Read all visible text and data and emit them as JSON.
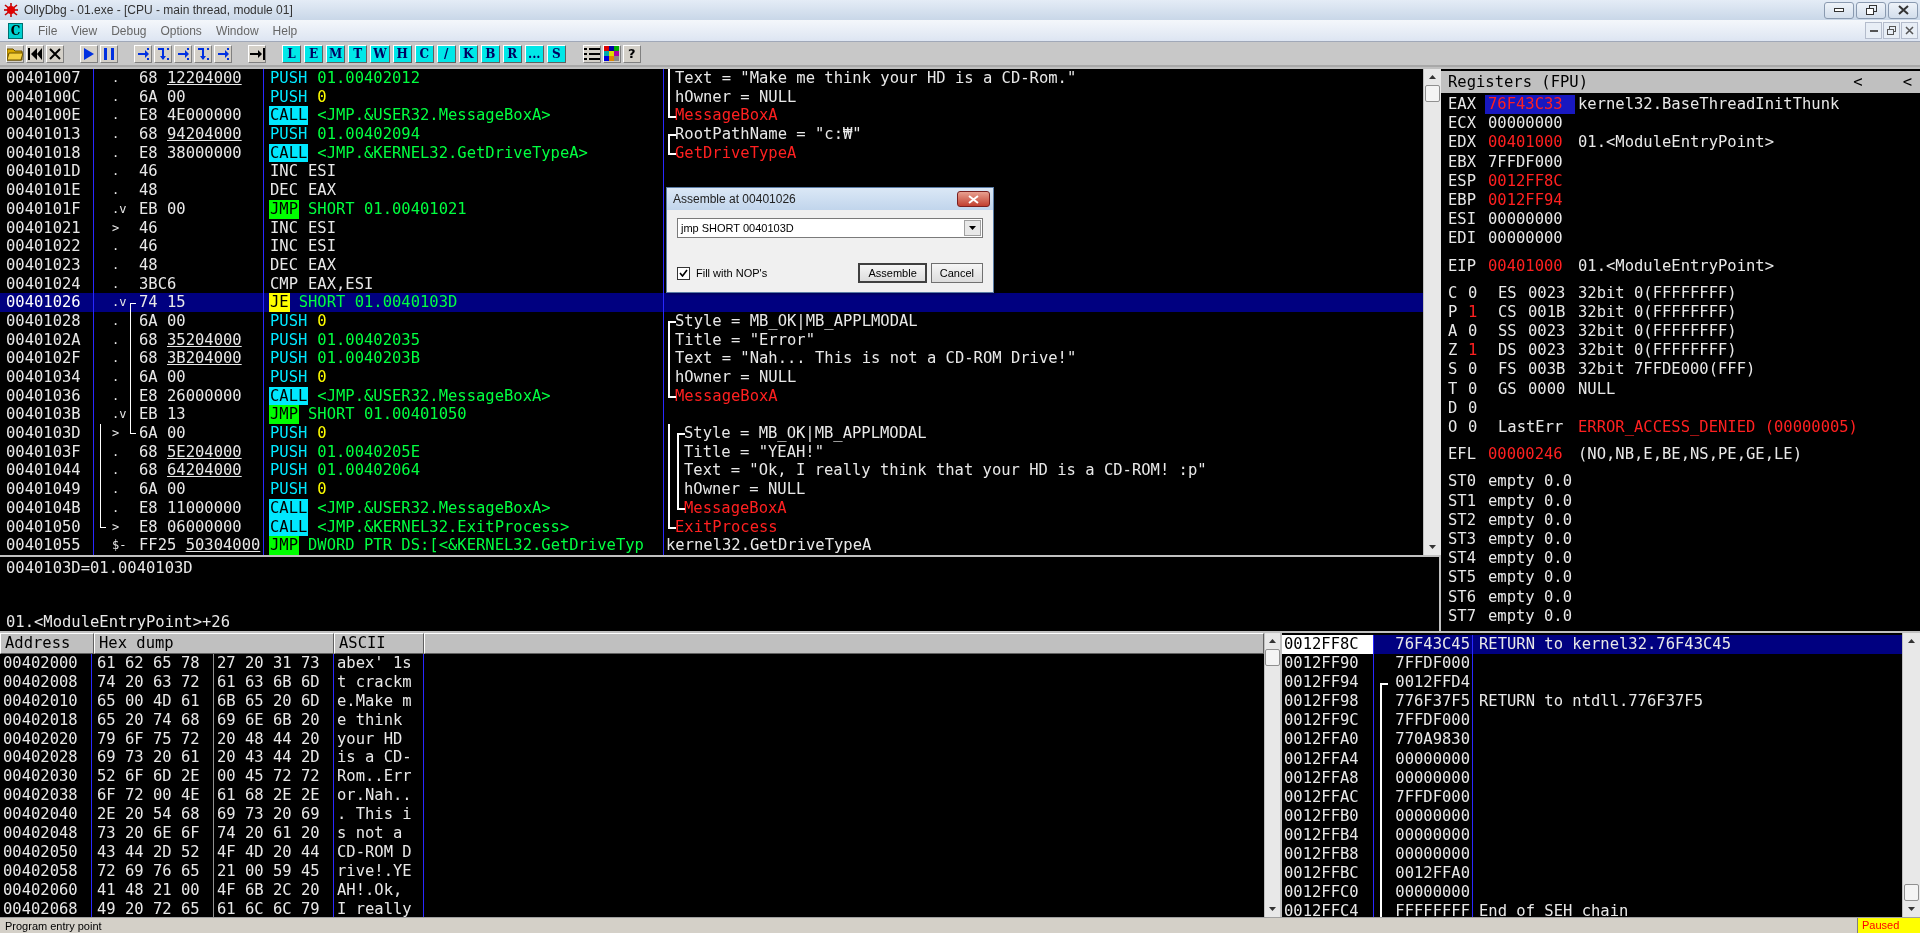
{
  "window": {
    "title": "OllyDbg - 01.exe - [CPU - main thread, module 01]"
  },
  "menu": {
    "cpu_badge": "C",
    "items": [
      "File",
      "View",
      "Debug",
      "Options",
      "Window",
      "Help"
    ]
  },
  "toolbar": {
    "letters": [
      "L",
      "E",
      "M",
      "T",
      "W",
      "H",
      "C",
      "/",
      "K",
      "B",
      "R",
      "...",
      "S"
    ],
    "help": "?"
  },
  "disassembly": {
    "rows": [
      {
        "address": "00401007",
        "marker": ".",
        "opcode": "68",
        "operand": "12204000",
        "fixup": true,
        "instruction": {
          "kind": "push",
          "mnemonic": "PUSH",
          "args": {
            "text": "01.00402012",
            "kind": "address"
          }
        },
        "selected": false,
        "comment": {
          "text": "Text = \"Make me think your HD is a CD-Rom.\"",
          "kind": "arg",
          "bracket": {
            "kind": "mid"
          }
        }
      },
      {
        "address": "0040100C",
        "marker": ".",
        "opcode": "6A",
        "operand": "00",
        "fixup": false,
        "instruction": {
          "kind": "push",
          "mnemonic": "PUSH",
          "args": {
            "text": "0",
            "kind": "const"
          }
        },
        "selected": false,
        "comment": {
          "text": "hOwner = NULL",
          "kind": "arg",
          "bracket": {
            "kind": "mid"
          }
        }
      },
      {
        "address": "0040100E",
        "marker": ".",
        "opcode": "E8",
        "operand": "4E000000",
        "fixup": false,
        "instruction": {
          "kind": "call",
          "mnemonic": "CALL",
          "args": {
            "text": "<JMP.&USER32.MessageBoxA>",
            "kind": "address"
          }
        },
        "selected": false,
        "comment": {
          "text": "MessageBoxA",
          "kind": "api",
          "bracket": {
            "kind": "end"
          }
        }
      },
      {
        "address": "00401013",
        "marker": ".",
        "opcode": "68",
        "operand": "94204000",
        "fixup": true,
        "instruction": {
          "kind": "push",
          "mnemonic": "PUSH",
          "args": {
            "text": "01.00402094",
            "kind": "address"
          }
        },
        "selected": false,
        "comment": {
          "text": "RootPathName = \"c:₩\"",
          "kind": "arg",
          "bracket": {
            "kind": "start"
          }
        }
      },
      {
        "address": "00401018",
        "marker": ".",
        "opcode": "E8",
        "operand": "38000000",
        "fixup": false,
        "instruction": {
          "kind": "call",
          "mnemonic": "CALL",
          "args": {
            "text": "<JMP.&KERNEL32.GetDriveTypeA>",
            "kind": "address"
          }
        },
        "selected": false,
        "comment": {
          "text": "GetDriveTypeA",
          "kind": "api",
          "bracket": {
            "kind": "end"
          }
        }
      },
      {
        "address": "0040101D",
        "marker": ".",
        "opcode": "46",
        "instruction": {
          "kind": "plain",
          "mnemonic": "INC",
          "args": {
            "text": "ESI",
            "kind": "plain"
          }
        },
        "selected": false
      },
      {
        "address": "0040101E",
        "marker": ".",
        "opcode": "48",
        "instruction": {
          "kind": "plain",
          "mnemonic": "DEC",
          "args": {
            "text": "EAX",
            "kind": "plain"
          }
        },
        "selected": false
      },
      {
        "address": "0040101F",
        "marker": ".v",
        "opcode": "EB",
        "operand": "00",
        "fixup": false,
        "instruction": {
          "kind": "jmp",
          "mnemonic": "JMP",
          "args": {
            "text": "SHORT 01.00401021",
            "kind": "address"
          }
        },
        "selected": false
      },
      {
        "address": "00401021",
        "marker": ">",
        "opcode": "46",
        "instruction": {
          "kind": "plain",
          "mnemonic": "INC",
          "args": {
            "text": "ESI",
            "kind": "plain"
          }
        },
        "selected": false
      },
      {
        "address": "00401022",
        "marker": ".",
        "opcode": "46",
        "instruction": {
          "kind": "plain",
          "mnemonic": "INC",
          "args": {
            "text": "ESI",
            "kind": "plain"
          }
        },
        "selected": false
      },
      {
        "address": "00401023",
        "marker": ".",
        "opcode": "48",
        "instruction": {
          "kind": "plain",
          "mnemonic": "DEC",
          "args": {
            "text": "EAX",
            "kind": "plain"
          }
        },
        "selected": false
      },
      {
        "address": "00401024",
        "marker": ".",
        "opcode": "3BC6",
        "instruction": {
          "kind": "plain",
          "mnemonic": "CMP",
          "args": {
            "text": "EAX,ESI",
            "kind": "plain"
          }
        },
        "selected": false
      },
      {
        "address": "00401026",
        "marker": ".v",
        "opcode": "74",
        "operand": "15",
        "fixup": false,
        "instruction": {
          "kind": "jcc",
          "mnemonic": "JE",
          "args": {
            "text": "SHORT 01.0040103D",
            "kind": "address"
          }
        },
        "selected": true,
        "jump": {
          "kind": "start"
        }
      },
      {
        "address": "00401028",
        "marker": ".",
        "opcode": "6A",
        "operand": "00",
        "fixup": false,
        "instruction": {
          "kind": "push",
          "mnemonic": "PUSH",
          "args": {
            "text": "0",
            "kind": "const"
          }
        },
        "selected": false,
        "jump": {
          "kind": "mid"
        },
        "comment": {
          "text": "Style = MB_OK|MB_APPLMODAL",
          "kind": "arg",
          "bracket": {
            "kind": "start"
          }
        }
      },
      {
        "address": "0040102A",
        "marker": ".",
        "opcode": "68",
        "operand": "35204000",
        "fixup": true,
        "instruction": {
          "kind": "push",
          "mnemonic": "PUSH",
          "args": {
            "text": "01.00402035",
            "kind": "address"
          }
        },
        "selected": false,
        "jump": {
          "kind": "mid"
        },
        "comment": {
          "text": "Title = \"Error\"",
          "kind": "arg",
          "bracket": {
            "kind": "mid"
          }
        }
      },
      {
        "address": "0040102F",
        "marker": ".",
        "opcode": "68",
        "operand": "3B204000",
        "fixup": true,
        "instruction": {
          "kind": "push",
          "mnemonic": "PUSH",
          "args": {
            "text": "01.0040203B",
            "kind": "address"
          }
        },
        "selected": false,
        "jump": {
          "kind": "mid"
        },
        "comment": {
          "text": "Text = \"Nah... This is not a CD-ROM Drive!\"",
          "kind": "arg",
          "bracket": {
            "kind": "mid"
          }
        }
      },
      {
        "address": "00401034",
        "marker": ".",
        "opcode": "6A",
        "operand": "00",
        "fixup": false,
        "instruction": {
          "kind": "push",
          "mnemonic": "PUSH",
          "args": {
            "text": "0",
            "kind": "const"
          }
        },
        "selected": false,
        "jump": {
          "kind": "mid"
        },
        "comment": {
          "text": "hOwner = NULL",
          "kind": "arg",
          "bracket": {
            "kind": "mid"
          }
        }
      },
      {
        "address": "00401036",
        "marker": ".",
        "opcode": "E8",
        "operand": "26000000",
        "fixup": false,
        "instruction": {
          "kind": "call",
          "mnemonic": "CALL",
          "args": {
            "text": "<JMP.&USER32.MessageBoxA>",
            "kind": "address"
          }
        },
        "selected": false,
        "jump": {
          "kind": "mid"
        },
        "comment": {
          "text": "MessageBoxA",
          "kind": "api",
          "bracket": {
            "kind": "end"
          }
        }
      },
      {
        "address": "0040103B",
        "marker": ".v",
        "opcode": "EB",
        "operand": "13",
        "fixup": false,
        "instruction": {
          "kind": "jmp",
          "mnemonic": "JMP",
          "args": {
            "text": "SHORT 01.00401050",
            "kind": "address"
          }
        },
        "selected": false,
        "jump": {
          "kind": "mid"
        }
      },
      {
        "address": "0040103D",
        "marker": ">",
        "opcode": "6A",
        "operand": "00",
        "fixup": false,
        "instruction": {
          "kind": "push",
          "mnemonic": "PUSH",
          "args": {
            "text": "0",
            "kind": "const"
          }
        },
        "selected": false,
        "jump": {
          "kind": "end"
        },
        "jump_outer": {
          "kind": "mid"
        },
        "comment": {
          "text": "Style = MB_OK|MB_APPLMODAL",
          "kind": "arg",
          "bracket": {
            "kind": "start"
          },
          "outer": {
            "kind": "mid"
          }
        }
      },
      {
        "address": "0040103F",
        "marker": ".",
        "opcode": "68",
        "operand": "5E204000",
        "fixup": true,
        "instruction": {
          "kind": "push",
          "mnemonic": "PUSH",
          "args": {
            "text": "01.0040205E",
            "kind": "address"
          }
        },
        "selected": false,
        "jump_outer": {
          "kind": "mid"
        },
        "comment": {
          "text": "Title = \"YEAH!\"",
          "kind": "arg",
          "bracket": {
            "kind": "mid"
          },
          "outer": {
            "kind": "mid"
          }
        }
      },
      {
        "address": "00401044",
        "marker": ".",
        "opcode": "68",
        "operand": "64204000",
        "fixup": true,
        "instruction": {
          "kind": "push",
          "mnemonic": "PUSH",
          "args": {
            "text": "01.00402064",
            "kind": "address"
          }
        },
        "selected": false,
        "jump_outer": {
          "kind": "mid"
        },
        "comment": {
          "text": "Text = \"Ok, I really think that your HD is a CD-ROM! :p\"",
          "kind": "arg",
          "bracket": {
            "kind": "mid"
          },
          "outer": {
            "kind": "mid"
          }
        }
      },
      {
        "address": "00401049",
        "marker": ".",
        "opcode": "6A",
        "operand": "00",
        "fixup": false,
        "instruction": {
          "kind": "push",
          "mnemonic": "PUSH",
          "args": {
            "text": "0",
            "kind": "const"
          }
        },
        "selected": false,
        "jump_outer": {
          "kind": "mid"
        },
        "comment": {
          "text": "hOwner = NULL",
          "kind": "arg",
          "bracket": {
            "kind": "mid"
          },
          "outer": {
            "kind": "mid"
          }
        }
      },
      {
        "address": "0040104B",
        "marker": ".",
        "opcode": "E8",
        "operand": "11000000",
        "fixup": false,
        "instruction": {
          "kind": "call",
          "mnemonic": "CALL",
          "args": {
            "text": "<JMP.&USER32.MessageBoxA>",
            "kind": "address"
          }
        },
        "selected": false,
        "jump_outer": {
          "kind": "mid"
        },
        "comment": {
          "text": "MessageBoxA",
          "kind": "api",
          "bracket": {
            "kind": "end"
          },
          "outer": {
            "kind": "mid"
          }
        }
      },
      {
        "address": "00401050",
        "marker": ">",
        "opcode": "E8",
        "operand": "06000000",
        "fixup": false,
        "instruction": {
          "kind": "call",
          "mnemonic": "CALL",
          "args": {
            "text": "<JMP.&KERNEL32.ExitProcess>",
            "kind": "address"
          }
        },
        "selected": false,
        "jump_outer": {
          "kind": "end"
        },
        "comment": {
          "text": "ExitProcess",
          "kind": "api",
          "bracket": {
            "kind": "end"
          }
        }
      },
      {
        "address": "00401055",
        "marker": "$-",
        "opcode": "FF25",
        "operand": "50304000",
        "fixup": true,
        "instruction": {
          "kind": "jmp",
          "mnemonic": "JMP",
          "args": {
            "text": "DWORD PTR DS:[<&KERNEL32.GetDriveTyp",
            "kind": "address"
          }
        },
        "selected": false,
        "comment": {
          "text": "kernel32.GetDriveTypeA",
          "kind": "plain"
        }
      }
    ]
  },
  "info": {
    "value_line": "0040103D=01.0040103D",
    "location": "01.<ModuleEntryPoint>+26"
  },
  "registers": {
    "title": "Registers (FPU)",
    "arrows": [
      "<",
      "<"
    ],
    "general": [
      {
        "name": "EAX",
        "value": "76F43C33",
        "changed": true,
        "selected": true,
        "comment": "kernel32.BaseThreadInitThunk"
      },
      {
        "name": "ECX",
        "value": "00000000",
        "changed": false,
        "selected": false
      },
      {
        "name": "EDX",
        "value": "00401000",
        "changed": true,
        "selected": false,
        "comment": "01.<ModuleEntryPoint>"
      },
      {
        "name": "EBX",
        "value": "7FFDF000",
        "changed": false,
        "selected": false
      },
      {
        "name": "ESP",
        "value": "0012FF8C",
        "changed": true,
        "selected": false
      },
      {
        "name": "EBP",
        "value": "0012FF94",
        "changed": true,
        "selected": false
      },
      {
        "name": "ESI",
        "value": "00000000",
        "changed": false,
        "selected": false
      },
      {
        "name": "EDI",
        "value": "00000000",
        "changed": false,
        "selected": false
      }
    ],
    "eip": {
      "name": "EIP",
      "value": "00401000",
      "changed": true,
      "selected": false,
      "comment": "01.<ModuleEntryPoint>"
    },
    "flags": [
      {
        "name": "C",
        "value": "0",
        "changed": false,
        "segment": {
          "name": "ES",
          "selector": "0023",
          "info": "32bit 0(FFFFFFFF)"
        }
      },
      {
        "name": "P",
        "value": "1",
        "changed": true,
        "segment": {
          "name": "CS",
          "selector": "001B",
          "info": "32bit 0(FFFFFFFF)"
        }
      },
      {
        "name": "A",
        "value": "0",
        "changed": false,
        "segment": {
          "name": "SS",
          "selector": "0023",
          "info": "32bit 0(FFFFFFFF)"
        }
      },
      {
        "name": "Z",
        "value": "1",
        "changed": true,
        "segment": {
          "name": "DS",
          "selector": "0023",
          "info": "32bit 0(FFFFFFFF)"
        }
      },
      {
        "name": "S",
        "value": "0",
        "changed": false,
        "segment": {
          "name": "FS",
          "selector": "003B",
          "info": "32bit 7FFDE000(FFF)"
        }
      },
      {
        "name": "T",
        "value": "0",
        "changed": false,
        "segment": {
          "name": "GS",
          "selector": "0000",
          "info": "NULL"
        }
      },
      {
        "name": "D",
        "value": "0",
        "changed": false
      },
      {
        "name": "O",
        "value": "0",
        "changed": false,
        "last_error": {
          "label": "LastErr",
          "value": "ERROR_ACCESS_DENIED (00000005)"
        }
      }
    ],
    "efl": {
      "name": "EFL",
      "value": "00000246",
      "changed": true,
      "selected": false,
      "comment": "(NO,NB,E,BE,NS,PE,GE,LE)"
    },
    "fpu": [
      {
        "name": "ST0",
        "value": "empty 0.0"
      },
      {
        "name": "ST1",
        "value": "empty 0.0"
      },
      {
        "name": "ST2",
        "value": "empty 0.0"
      },
      {
        "name": "ST3",
        "value": "empty 0.0"
      },
      {
        "name": "ST4",
        "value": "empty 0.0"
      },
      {
        "name": "ST5",
        "value": "empty 0.0"
      },
      {
        "name": "ST6",
        "value": "empty 0.0"
      },
      {
        "name": "ST7",
        "value": "empty 0.0"
      }
    ]
  },
  "dump": {
    "columns": [
      "Address",
      "Hex dump",
      "ASCII"
    ],
    "rows": [
      {
        "address": "00402000",
        "hex": [
          "61 62 65 78",
          "27 20 31 73"
        ],
        "ascii": "abex' 1s"
      },
      {
        "address": "00402008",
        "hex": [
          "74 20 63 72",
          "61 63 6B 6D"
        ],
        "ascii": "t crackm"
      },
      {
        "address": "00402010",
        "hex": [
          "65 00 4D 61",
          "6B 65 20 6D"
        ],
        "ascii": "e.Make m"
      },
      {
        "address": "00402018",
        "hex": [
          "65 20 74 68",
          "69 6E 6B 20"
        ],
        "ascii": "e think"
      },
      {
        "address": "00402020",
        "hex": [
          "79 6F 75 72",
          "20 48 44 20"
        ],
        "ascii": "your HD"
      },
      {
        "address": "00402028",
        "hex": [
          "69 73 20 61",
          "20 43 44 2D"
        ],
        "ascii": "is a CD-"
      },
      {
        "address": "00402030",
        "hex": [
          "52 6F 6D 2E",
          "00 45 72 72"
        ],
        "ascii": "Rom..Err"
      },
      {
        "address": "00402038",
        "hex": [
          "6F 72 00 4E",
          "61 68 2E 2E"
        ],
        "ascii": "or.Nah.."
      },
      {
        "address": "00402040",
        "hex": [
          "2E 20 54 68",
          "69 73 20 69"
        ],
        "ascii": ". This i"
      },
      {
        "address": "00402048",
        "hex": [
          "73 20 6E 6F",
          "74 20 61 20"
        ],
        "ascii": "s not a"
      },
      {
        "address": "00402050",
        "hex": [
          "43 44 2D 52",
          "4F 4D 20 44"
        ],
        "ascii": "CD-ROM D"
      },
      {
        "address": "00402058",
        "hex": [
          "72 69 76 65",
          "21 00 59 45"
        ],
        "ascii": "rive!.YE"
      },
      {
        "address": "00402060",
        "hex": [
          "41 48 21 00",
          "4F 6B 2C 20"
        ],
        "ascii": "AH!.Ok,"
      },
      {
        "address": "00402068",
        "hex": [
          "49 20 72 65",
          "61 6C 6C 79"
        ],
        "ascii": "I really"
      }
    ]
  },
  "stack": {
    "rows": [
      {
        "address": "0012FF8C",
        "value": "76F43C45",
        "comment": "RETURN to kernel32.76F43C45",
        "selected": true
      },
      {
        "address": "0012FF90",
        "value": "7FFDF000",
        "selected": false
      },
      {
        "address": "0012FF94",
        "value": "0012FFD4",
        "selected": false,
        "bracket": {
          "kind": "start"
        }
      },
      {
        "address": "0012FF98",
        "value": "776F37F5",
        "comment": "RETURN to ntdll.776F37F5",
        "selected": false,
        "bracket": {
          "kind": "mid"
        }
      },
      {
        "address": "0012FF9C",
        "value": "7FFDF000",
        "selected": false,
        "bracket": {
          "kind": "mid"
        }
      },
      {
        "address": "0012FFA0",
        "value": "770A9830",
        "selected": false,
        "bracket": {
          "kind": "mid"
        }
      },
      {
        "address": "0012FFA4",
        "value": "00000000",
        "selected": false,
        "bracket": {
          "kind": "mid"
        }
      },
      {
        "address": "0012FFA8",
        "value": "00000000",
        "selected": false,
        "bracket": {
          "kind": "mid"
        }
      },
      {
        "address": "0012FFAC",
        "value": "7FFDF000",
        "selected": false,
        "bracket": {
          "kind": "mid"
        }
      },
      {
        "address": "0012FFB0",
        "value": "00000000",
        "selected": false,
        "bracket": {
          "kind": "mid"
        }
      },
      {
        "address": "0012FFB4",
        "value": "00000000",
        "selected": false,
        "bracket": {
          "kind": "mid"
        }
      },
      {
        "address": "0012FFB8",
        "value": "00000000",
        "selected": false,
        "bracket": {
          "kind": "mid"
        }
      },
      {
        "address": "0012FFBC",
        "value": "0012FFA0",
        "selected": false,
        "bracket": {
          "kind": "mid"
        }
      },
      {
        "address": "0012FFC0",
        "value": "00000000",
        "selected": false,
        "bracket": {
          "kind": "mid"
        }
      },
      {
        "address": "0012FFC4",
        "value": "FFFFFFFF",
        "comment": "End of SEH chain",
        "selected": false,
        "bracket": {
          "kind": "mid"
        }
      }
    ]
  },
  "dialog": {
    "title": "Assemble at 00401026",
    "command": "jmp SHORT 0040103D",
    "fill_nops": {
      "label": "Fill with NOP's",
      "checked": true
    },
    "buttons": [
      "Assemble",
      "Cancel"
    ]
  },
  "status_bar": {
    "message": "Program entry point",
    "state": "Paused"
  }
}
